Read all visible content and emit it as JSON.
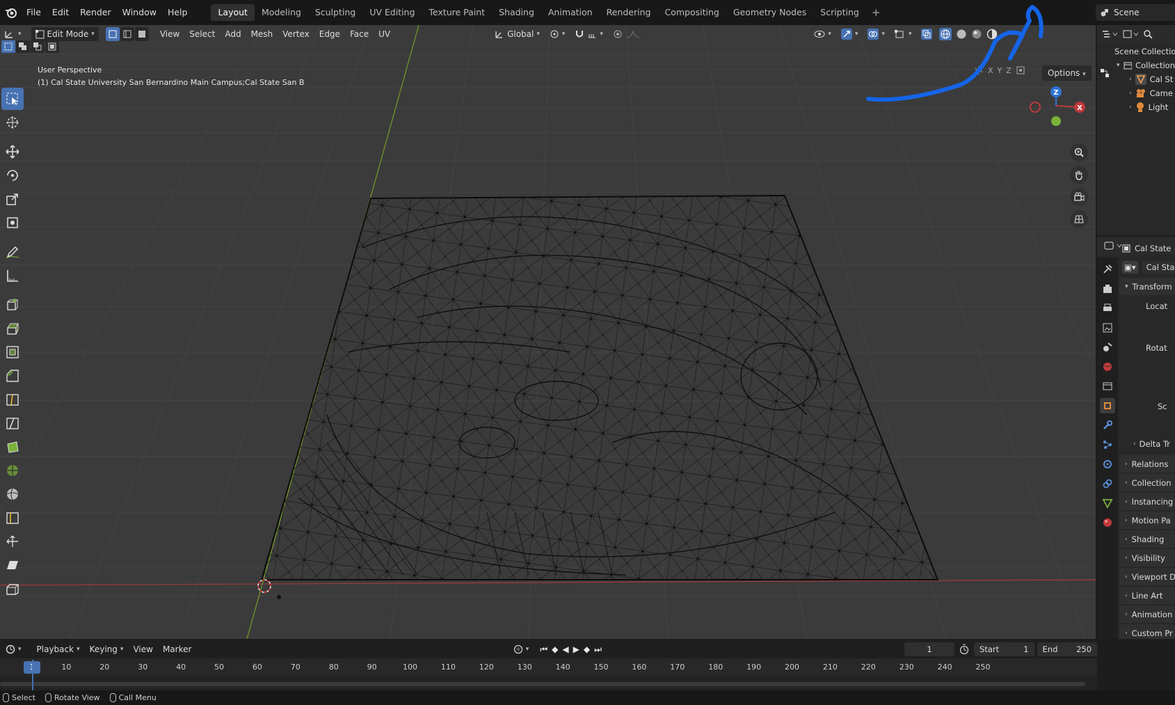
{
  "menu": [
    "File",
    "Edit",
    "Render",
    "Window",
    "Help"
  ],
  "workspaces": [
    "Layout",
    "Modeling",
    "Sculpting",
    "UV Editing",
    "Texture Paint",
    "Shading",
    "Animation",
    "Rendering",
    "Compositing",
    "Geometry Nodes",
    "Scripting"
  ],
  "active_workspace": "Layout",
  "scene": "Scene",
  "viewport": {
    "mode": "Edit Mode",
    "header_menus": [
      "View",
      "Select",
      "Add",
      "Mesh",
      "Vertex",
      "Edge",
      "Face",
      "UV"
    ],
    "transform_orientation": "Global",
    "options_label": "Options",
    "axes": [
      "X",
      "Y",
      "Z"
    ],
    "perspective_label": "User Perspective",
    "object_label": "(1) Cal State University San Bernardino Main Campus;Cal State San B"
  },
  "gizmo": {
    "z": "Z",
    "x": "X"
  },
  "outliner": {
    "root": "Scene Collection",
    "collection": "Collection",
    "items": [
      "Cal St",
      "Came",
      "Light"
    ]
  },
  "properties": {
    "object_name": "Cal State",
    "data_name": "Cal Sta",
    "transform": "Transform",
    "location": "Locat",
    "rotation": "Rotat",
    "scale": "Sc",
    "delta": "Delta Tr",
    "panels": [
      "Relations",
      "Collection",
      "Instancing",
      "Motion Pa",
      "Shading",
      "Visibility",
      "Viewport D",
      "Line Art",
      "Animation",
      "Custom Pr"
    ]
  },
  "timeline": {
    "menus": [
      "Playback",
      "Keying",
      "View",
      "Marker"
    ],
    "current_frame": "1",
    "start_label": "Start",
    "start": "1",
    "end_label": "End",
    "end": "250",
    "ticks": [
      "10",
      "20",
      "30",
      "40",
      "50",
      "60",
      "70",
      "80",
      "90",
      "100",
      "110",
      "120",
      "130",
      "140",
      "150",
      "160",
      "170",
      "180",
      "190",
      "200",
      "210",
      "220",
      "230",
      "240",
      "250"
    ],
    "ruler_current": "1"
  },
  "status": [
    "Select",
    "Rotate View",
    "Call Menu"
  ],
  "colors": {
    "accent": "#4772b3",
    "annotation": "#1565e8",
    "x_axis": "#c0393b",
    "y_axis": "#7ab23a",
    "z_axis": "#2f73d6"
  }
}
